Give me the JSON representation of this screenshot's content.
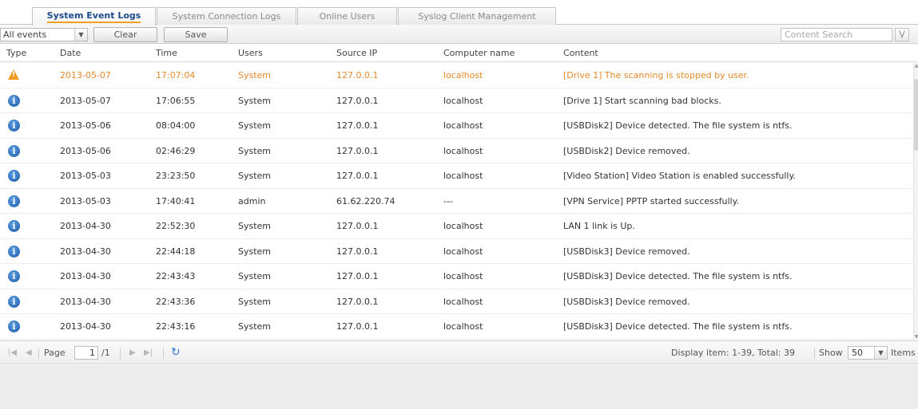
{
  "tabs": [
    {
      "label": "System Event Logs",
      "active": true
    },
    {
      "label": "System Connection Logs",
      "active": false
    },
    {
      "label": "Online Users",
      "active": false
    },
    {
      "label": "Syslog Client Management",
      "active": false
    }
  ],
  "toolbar": {
    "filter_value": "All events",
    "clear_label": "Clear",
    "save_label": "Save",
    "search_placeholder": "Content Search"
  },
  "columns": [
    "Type",
    "Date",
    "Time",
    "Users",
    "Source IP",
    "Computer name",
    "Content"
  ],
  "rows": [
    {
      "type": "warning",
      "icon": "warning-icon",
      "date": "2013-05-07",
      "time": "17:07:04",
      "user": "System",
      "ip": "127.0.0.1",
      "computer": "localhost",
      "content": "[Drive 1] The scanning is stopped by user."
    },
    {
      "type": "info",
      "icon": "info-icon",
      "date": "2013-05-07",
      "time": "17:06:55",
      "user": "System",
      "ip": "127.0.0.1",
      "computer": "localhost",
      "content": "[Drive 1] Start scanning bad blocks."
    },
    {
      "type": "info",
      "icon": "info-icon",
      "date": "2013-05-06",
      "time": "08:04:00",
      "user": "System",
      "ip": "127.0.0.1",
      "computer": "localhost",
      "content": "[USBDisk2] Device detected. The file system is ntfs."
    },
    {
      "type": "info",
      "icon": "info-icon",
      "date": "2013-05-06",
      "time": "02:46:29",
      "user": "System",
      "ip": "127.0.0.1",
      "computer": "localhost",
      "content": "[USBDisk2] Device removed."
    },
    {
      "type": "info",
      "icon": "info-icon",
      "date": "2013-05-03",
      "time": "23:23:50",
      "user": "System",
      "ip": "127.0.0.1",
      "computer": "localhost",
      "content": "[Video Station] Video Station is enabled successfully."
    },
    {
      "type": "info",
      "icon": "info-icon",
      "date": "2013-05-03",
      "time": "17:40:41",
      "user": "admin",
      "ip": "61.62.220.74",
      "computer": "---",
      "content": "[VPN Service] PPTP started successfully."
    },
    {
      "type": "info",
      "icon": "info-icon",
      "date": "2013-04-30",
      "time": "22:52:30",
      "user": "System",
      "ip": "127.0.0.1",
      "computer": "localhost",
      "content": "LAN 1 link is Up."
    },
    {
      "type": "info",
      "icon": "info-icon",
      "date": "2013-04-30",
      "time": "22:44:18",
      "user": "System",
      "ip": "127.0.0.1",
      "computer": "localhost",
      "content": "[USBDisk3] Device removed."
    },
    {
      "type": "info",
      "icon": "info-icon",
      "date": "2013-04-30",
      "time": "22:43:43",
      "user": "System",
      "ip": "127.0.0.1",
      "computer": "localhost",
      "content": "[USBDisk3] Device detected. The file system is ntfs."
    },
    {
      "type": "info",
      "icon": "info-icon",
      "date": "2013-04-30",
      "time": "22:43:36",
      "user": "System",
      "ip": "127.0.0.1",
      "computer": "localhost",
      "content": "[USBDisk3] Device removed."
    },
    {
      "type": "info",
      "icon": "info-icon",
      "date": "2013-04-30",
      "time": "22:43:16",
      "user": "System",
      "ip": "127.0.0.1",
      "computer": "localhost",
      "content": "[USBDisk3] Device detected. The file system is ntfs."
    }
  ],
  "pager": {
    "page_label": "Page",
    "page_value": "1",
    "page_total": "/1",
    "display_text": "Display item: 1-39, Total: 39",
    "show_label": "Show",
    "show_value": "50",
    "items_label": "Items"
  },
  "colors": {
    "warning": "#e48a2a",
    "info": "#1a5aa8",
    "active_tab_text": "#1e4a8c",
    "active_tab_underline": "#f0a020"
  }
}
